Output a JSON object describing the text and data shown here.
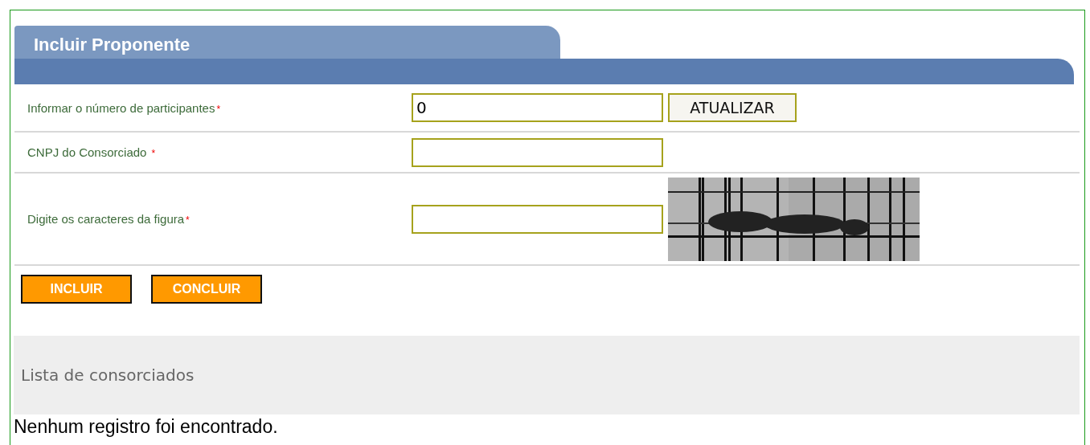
{
  "panel": {
    "title": "Incluir Proponente"
  },
  "form_rows": [
    {
      "kind": "input_button",
      "label": "Informar o número de participantes",
      "required_mark": "*",
      "value": "0",
      "button": "ATUALIZAR"
    },
    {
      "kind": "input",
      "label": "CNPJ do Consorciado",
      "required_mark": "*",
      "value": ""
    },
    {
      "kind": "captcha",
      "label": "Digite os caracteres da figura",
      "required_mark": "*",
      "value": ""
    }
  ],
  "actions": [
    "INCLUIR",
    "CONCLUIR"
  ],
  "list": {
    "title": "Lista de consorciados",
    "empty_message": "Nenhum registro foi encontrado."
  }
}
